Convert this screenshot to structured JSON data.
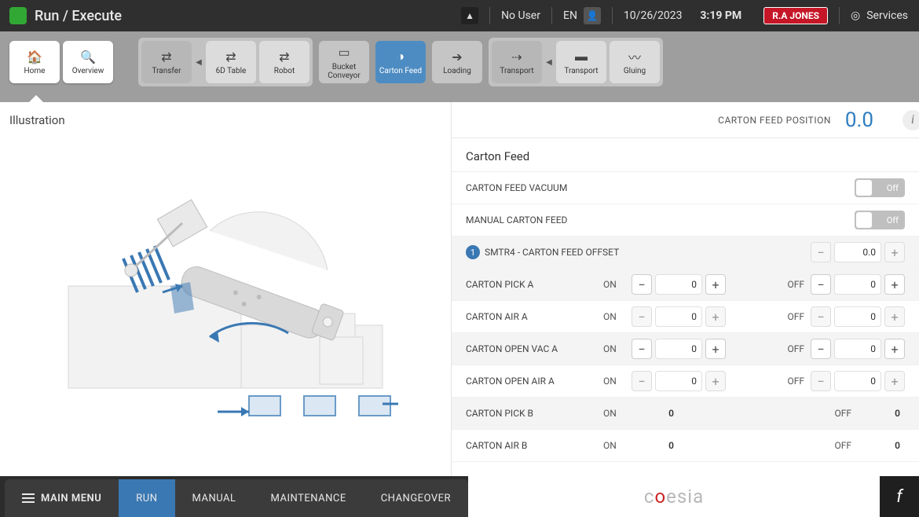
{
  "header": {
    "title": "Run / Execute",
    "user": "No User",
    "lang": "EN",
    "date": "10/26/2023",
    "time": "3:19 PM",
    "brand": "R.A JONES",
    "services": "Services"
  },
  "ribbon": {
    "home": "Home",
    "overview": "Overview",
    "transfer": "Transfer",
    "table6d": "6D Table",
    "robot": "Robot",
    "bucket_conveyor": "Bucket Conveyor",
    "carton_feed": "Carton Feed",
    "loading": "Loading",
    "transport_group": "Transport",
    "transport": "Transport",
    "gluing": "Gluing"
  },
  "left": {
    "title": "Illustration"
  },
  "right": {
    "position_label": "CARTON FEED POSITION",
    "position_value": "0.0",
    "section_title": "Carton Feed",
    "toggle_off": "Off",
    "rows": {
      "vacuum": "CARTON FEED VACUUM",
      "manual": "MANUAL CARTON FEED",
      "offset_badge": "1",
      "offset_label": "SMTR4 - CARTON FEED OFFSET",
      "offset_value": "0.0",
      "on": "ON",
      "off": "OFF",
      "pick_a": "CARTON PICK A",
      "air_a": "CARTON AIR A",
      "open_vac_a": "CARTON OPEN VAC A",
      "open_air_a": "CARTON OPEN AIR A",
      "pick_b": "CARTON PICK B",
      "air_b": "CARTON AIR B",
      "zero": "0"
    }
  },
  "bottom": {
    "main_menu": "MAIN MENU",
    "run": "RUN",
    "manual": "MANUAL",
    "maintenance": "MAINTENANCE",
    "changeover": "CHANGEOVER",
    "logo_pre": "c",
    "logo_accent": "o",
    "logo_post": "esia",
    "f": "f"
  }
}
